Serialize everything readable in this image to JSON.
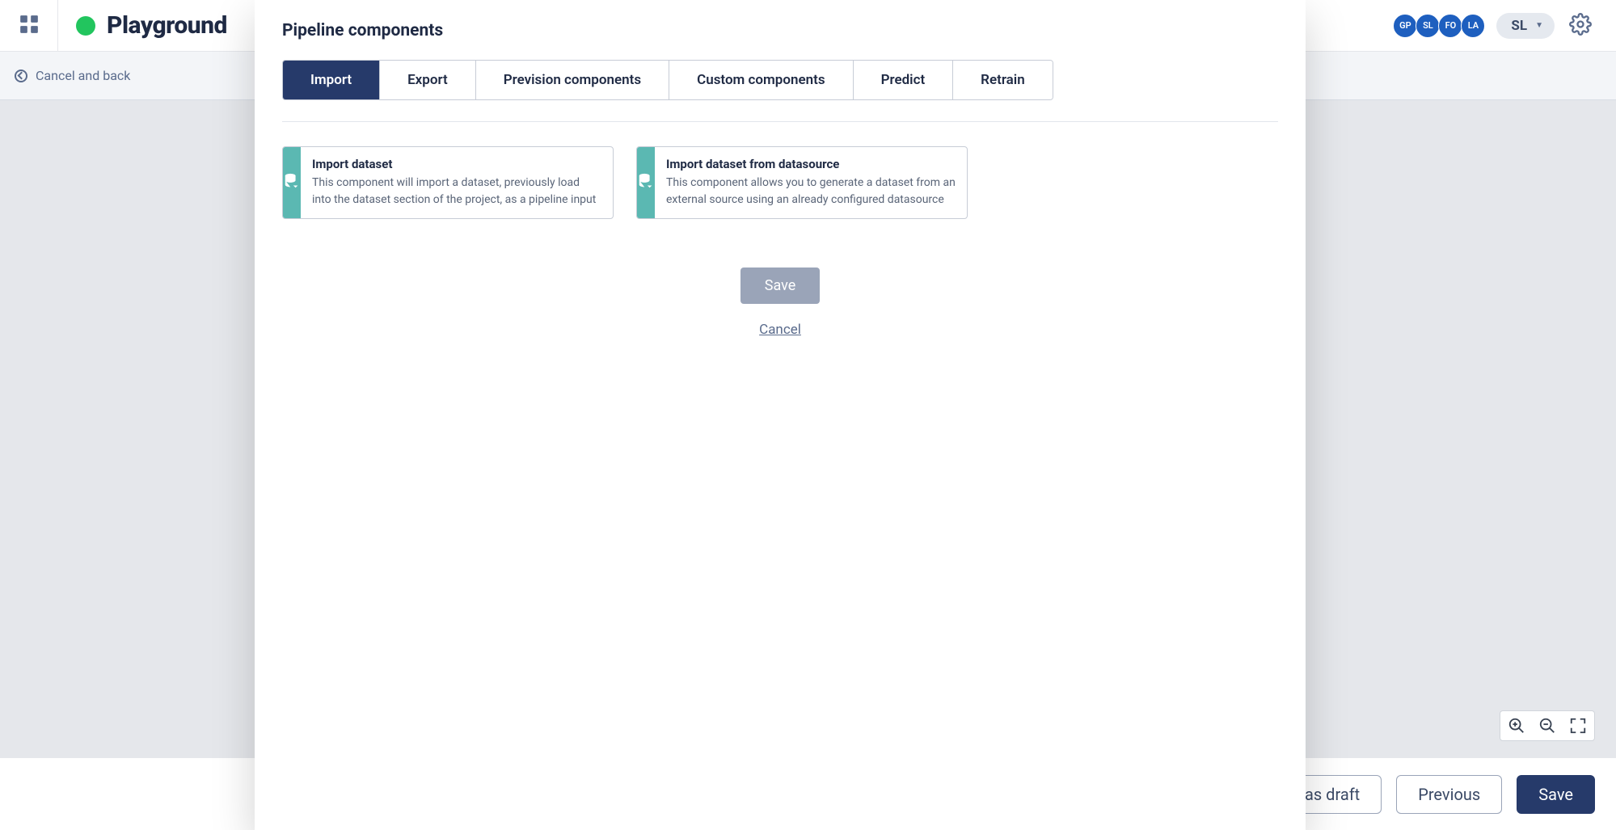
{
  "topbar": {
    "title": "Playground",
    "avatars": [
      {
        "initials": "GP",
        "color": "#1e5fbf"
      },
      {
        "initials": "SL",
        "color": "#1e5fbf"
      },
      {
        "initials": "FO",
        "color": "#1e5fbf"
      },
      {
        "initials": "LA",
        "color": "#1e5fbf"
      }
    ],
    "current_user": "SL"
  },
  "back": {
    "label": "Cancel and back"
  },
  "footer": {
    "draft": "e as draft",
    "previous": "Previous",
    "save": "Save"
  },
  "modal": {
    "title": "Pipeline components",
    "tabs": [
      "Import",
      "Export",
      "Prevision components",
      "Custom components",
      "Predict",
      "Retrain"
    ],
    "active_tab": 0,
    "cards": [
      {
        "title": "Import dataset",
        "desc": "This component will import a dataset, previously load into the dataset section of the project, as a pipeline input"
      },
      {
        "title": "Import dataset from datasource",
        "desc": "This component allows you to generate a dataset from an external source using an already configured datasource"
      }
    ],
    "save": "Save",
    "cancel": "Cancel"
  }
}
